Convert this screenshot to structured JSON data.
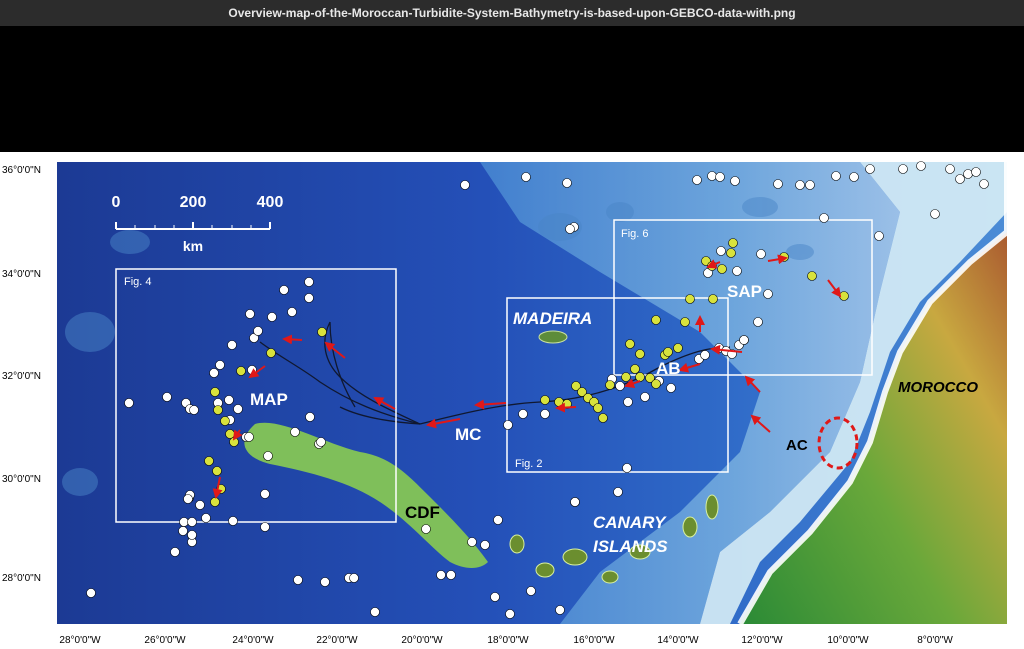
{
  "window": {
    "title": "Overview-map-of-the-Moroccan-Turbidite-System-Bathymetry-is-based-upon-GEBCO-data-with.png"
  },
  "map": {
    "lat_labels": [
      "36°0'0\"N",
      "34°0'0\"N",
      "32°0'0\"N",
      "30°0'0\"N",
      "28°0'0\"N"
    ],
    "lon_labels": [
      "28°0'0\"W",
      "26°0'0\"W",
      "24°0'0\"W",
      "22°0'0\"W",
      "20°0'0\"W",
      "18°0'0\"W",
      "16°0'0\"W",
      "14°0'0\"W",
      "12°0'0\"W",
      "10°0'0\"W",
      "8°0'0\"W"
    ],
    "scale": {
      "ticks": [
        "0",
        "200",
        "400"
      ],
      "unit": "km"
    },
    "boxes": {
      "fig4": "Fig. 4",
      "fig6": "Fig. 6",
      "fig2": "Fig. 2"
    },
    "labels": {
      "madeira": "MADEIRA",
      "ab": "AB",
      "sap": "SAP",
      "map": "MAP",
      "mc": "MC",
      "cdf": "CDF",
      "canary1": "CANARY",
      "canary2": "ISLANDS",
      "ac": "AC",
      "morocco": "MOROCCO"
    },
    "colors": {
      "deep_ocean": "#1a3fa0",
      "abyssal": "#2b5cc4",
      "slope": "#4a8fd8",
      "shelf": "#bfe4f0",
      "land_low": "#2e8a3a",
      "land_high": "#d8b23a",
      "cdf": "#7fbf5a",
      "core_white": "#ffffff",
      "core_yellow": "#d8e23c",
      "arrow": "#e01818",
      "box": "#ffffff"
    }
  }
}
